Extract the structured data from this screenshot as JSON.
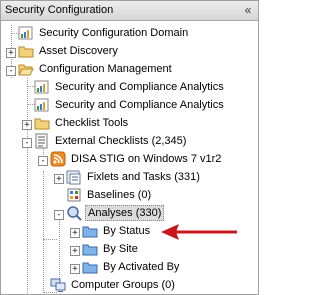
{
  "panel": {
    "title": "Security Configuration",
    "collapse_glyph": "«"
  },
  "tree": {
    "nodes": [
      {
        "label": "Security Configuration Domain",
        "icon": "domain-icon"
      },
      {
        "label": "Asset Discovery",
        "icon": "folder-icon",
        "expander": "+"
      },
      {
        "label": "Configuration Management",
        "icon": "folder-open-icon",
        "expander": "-"
      },
      {
        "label": "Security and Compliance Analytics",
        "icon": "chart-icon"
      },
      {
        "label": "Security and Compliance Analytics",
        "icon": "chart-icon"
      },
      {
        "label": "Checklist Tools",
        "icon": "folder-icon",
        "expander": "+"
      },
      {
        "label": "External Checklists (2,345)",
        "icon": "list-icon",
        "expander": "-"
      },
      {
        "label": "DISA STIG on Windows 7 v1r2",
        "icon": "rss-icon",
        "expander": "-"
      },
      {
        "label": "Fixlets and Tasks (331)",
        "icon": "fixlet-icon",
        "expander": "+"
      },
      {
        "label": "Baselines (0)",
        "icon": "baseline-icon"
      },
      {
        "label": "Analyses (330)",
        "icon": "analysis-icon",
        "expander": "-"
      },
      {
        "label": "By Status",
        "icon": "folder-icon",
        "expander": "+"
      },
      {
        "label": "By Site",
        "icon": "folder-icon",
        "expander": "+"
      },
      {
        "label": "By Activated By",
        "icon": "folder-icon",
        "expander": "+"
      },
      {
        "label": "Computer Groups (0)",
        "icon": "computer-group-icon"
      }
    ]
  },
  "colors": {
    "selection": "#dcdcdc",
    "arrow": "#c8181e",
    "folder": "#f3d27a"
  }
}
